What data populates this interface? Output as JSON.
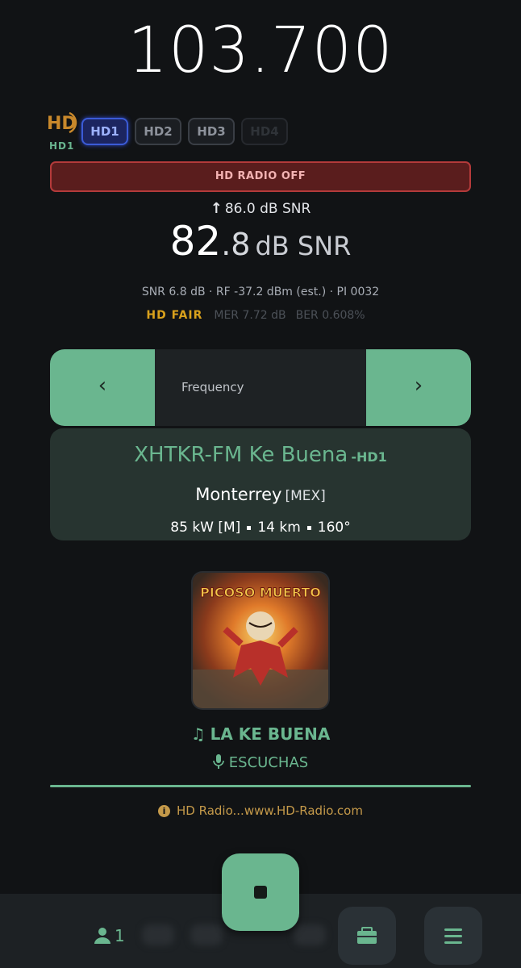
{
  "frequency": "103.700",
  "hd": {
    "logo_label": "HD1",
    "channels": [
      "HD1",
      "HD2",
      "HD3",
      "HD4"
    ]
  },
  "banner": "HD RADIO OFF",
  "signal": {
    "peak": "86.0 dB SNR",
    "snr_int": "82",
    "snr_dec": ".8",
    "snr_unit": "dB SNR",
    "stats": "SNR 6.8 dB · RF -37.2 dBm (est.) · PI 0032",
    "hd_quality": "HD FAIR",
    "mer": "MER 7.72 dB",
    "ber": "BER 0.608%"
  },
  "tuner": {
    "prev": "‹",
    "label": "Frequency",
    "next": "›"
  },
  "station": {
    "name": "XHTKR-FM Ke Buena",
    "suffix": "-HD1",
    "city": "Monterrey",
    "country": "[MEX]",
    "power": "85 kW [M]",
    "distance": "14 km",
    "bearing": "160°"
  },
  "album_art": {
    "title": "PICOSO MUERTO"
  },
  "now_playing": {
    "song": "LA KE BUENA",
    "artist": "ESCUCHAS"
  },
  "info_text": "HD Radio...www.HD-Radio.com",
  "bottom": {
    "users": "1"
  },
  "colors": {
    "accent": "#6ab68f",
    "background": "#111315",
    "warning": "#d9a11c",
    "error_bg": "#5a1d1d"
  }
}
